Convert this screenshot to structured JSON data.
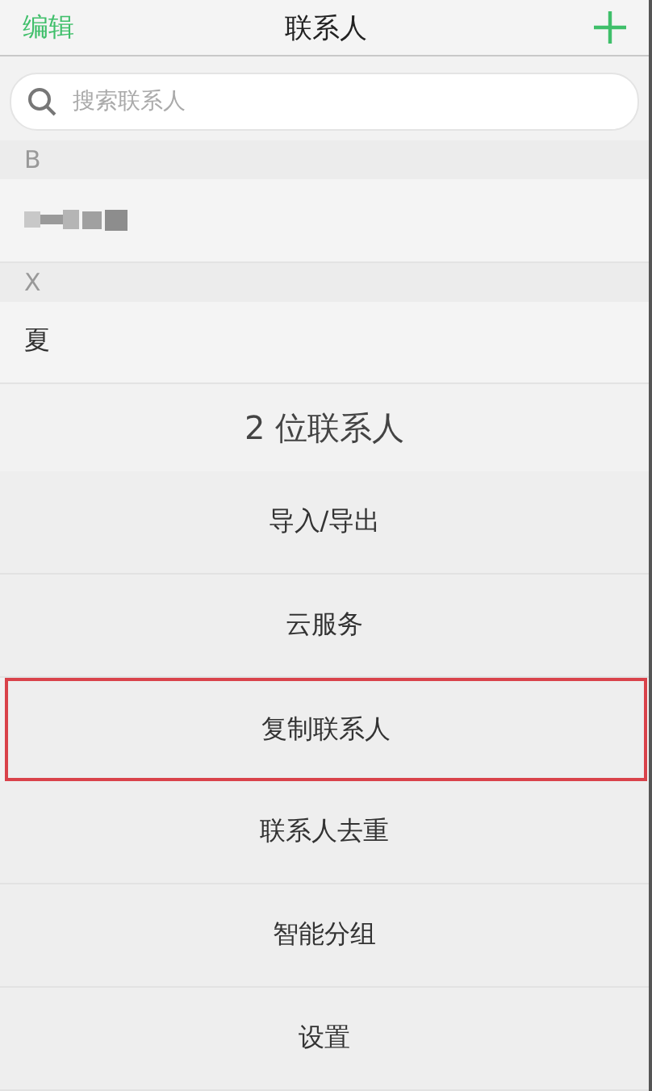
{
  "header": {
    "edit": "编辑",
    "title": "联系人"
  },
  "search": {
    "placeholder": "搜索联系人"
  },
  "sections": [
    {
      "letter": "B",
      "contacts": [
        {
          "kind": "blurred"
        }
      ]
    },
    {
      "letter": "X",
      "contacts": [
        {
          "name": "夏",
          "kind": "text"
        }
      ]
    }
  ],
  "count": "2 位联系人",
  "menu": [
    {
      "label": "导入/导出",
      "highlighted": false
    },
    {
      "label": "云服务",
      "highlighted": false
    },
    {
      "label": "复制联系人",
      "highlighted": true
    },
    {
      "label": "联系人去重",
      "highlighted": false
    },
    {
      "label": "智能分组",
      "highlighted": false
    },
    {
      "label": "设置",
      "highlighted": false
    }
  ]
}
